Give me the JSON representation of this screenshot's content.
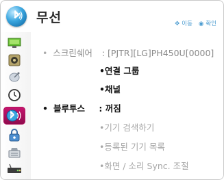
{
  "header": {
    "title": "무선",
    "hint_move": "이동",
    "hint_confirm": "확인",
    "title_icon": "bluetooth-globe-icon"
  },
  "sidebar": {
    "items": [
      {
        "icon": "picture-monitor-icon"
      },
      {
        "icon": "sound-speaker-icon"
      },
      {
        "icon": "satellite-dish-icon"
      },
      {
        "icon": "clock-icon"
      },
      {
        "icon": "bluetooth-wireless-icon",
        "selected": true
      },
      {
        "icon": "lock-icon"
      },
      {
        "icon": "settings-keyboard-icon"
      },
      {
        "icon": "network-device-icon"
      }
    ]
  },
  "menu": {
    "screen_share_label": "스크린쉐어",
    "screen_share_value": ": [PJTR][LG]PH450U[0000]",
    "connect_group": "연결 그룹",
    "channel": "채널",
    "bluetooth_label": "블루투스",
    "bluetooth_value": ": 꺼짐",
    "device_search": "기기 검색하기",
    "registered_devices": "등록된 기기 목록",
    "av_sync": "화면 / 소리 Sync. 조절"
  },
  "colors": {
    "selected_bg": "#b3125f",
    "accent": "#4a9bd0"
  }
}
